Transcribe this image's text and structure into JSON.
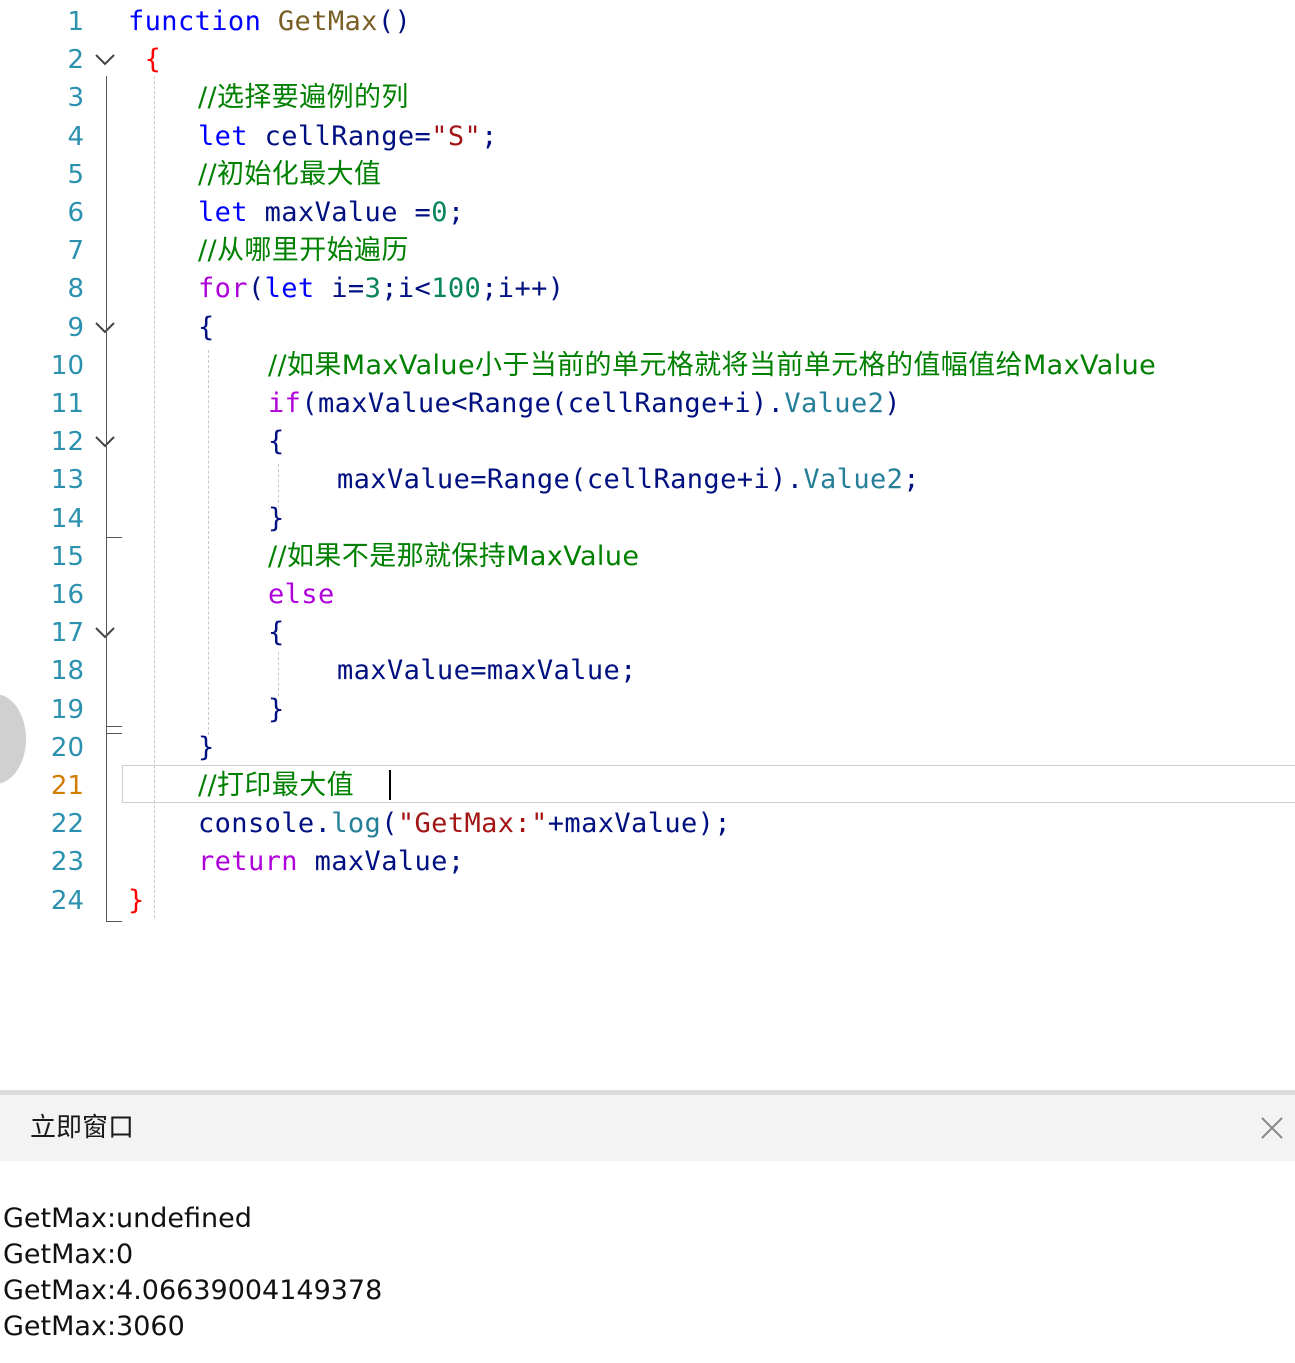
{
  "editor": {
    "active_line": 21,
    "lines": [
      {
        "n": "1",
        "fold": "",
        "indent": 0,
        "tokens": [
          [
            "kw",
            "function"
          ],
          [
            "plain",
            " "
          ],
          [
            "fn",
            "GetMax"
          ],
          [
            "plain",
            "()"
          ]
        ]
      },
      {
        "n": "2",
        "fold": "open",
        "indent": 0,
        "tokens": [
          [
            "plain",
            " "
          ],
          [
            "brace",
            "{"
          ]
        ]
      },
      {
        "n": "3",
        "fold": "",
        "indent": 1,
        "tokens": [
          [
            "cm",
            "//选择要遍例的列"
          ]
        ]
      },
      {
        "n": "4",
        "fold": "",
        "indent": 1,
        "tokens": [
          [
            "kw",
            "let"
          ],
          [
            "plain",
            " cellRange="
          ],
          [
            "str",
            "\"S\""
          ],
          [
            "plain",
            ";"
          ]
        ]
      },
      {
        "n": "5",
        "fold": "",
        "indent": 1,
        "tokens": [
          [
            "cm",
            "//初始化最大值"
          ]
        ]
      },
      {
        "n": "6",
        "fold": "",
        "indent": 1,
        "tokens": [
          [
            "kw",
            "let"
          ],
          [
            "plain",
            " maxValue ="
          ],
          [
            "num",
            "0"
          ],
          [
            "plain",
            ";"
          ]
        ]
      },
      {
        "n": "7",
        "fold": "",
        "indent": 1,
        "tokens": [
          [
            "cm",
            "//从哪里开始遍历"
          ]
        ]
      },
      {
        "n": "8",
        "fold": "",
        "indent": 1,
        "tokens": [
          [
            "ctl",
            "for"
          ],
          [
            "plain",
            "("
          ],
          [
            "kw",
            "let"
          ],
          [
            "plain",
            " i="
          ],
          [
            "num",
            "3"
          ],
          [
            "plain",
            ";i<"
          ],
          [
            "num",
            "100"
          ],
          [
            "plain",
            ";i++)"
          ]
        ]
      },
      {
        "n": "9",
        "fold": "open",
        "indent": 1,
        "tokens": [
          [
            "plain",
            "{"
          ]
        ]
      },
      {
        "n": "10",
        "fold": "",
        "indent": 2,
        "tokens": [
          [
            "cm",
            "//如果MaxValue小于当前的单元格就将当前单元格的值幅值给MaxValue"
          ]
        ]
      },
      {
        "n": "11",
        "fold": "",
        "indent": 2,
        "tokens": [
          [
            "ctl",
            "if"
          ],
          [
            "plain",
            "(maxValue<Range(cellRange+i)."
          ],
          [
            "prop",
            "Value2"
          ],
          [
            "plain",
            ")"
          ]
        ]
      },
      {
        "n": "12",
        "fold": "open",
        "indent": 2,
        "tokens": [
          [
            "plain",
            "{"
          ]
        ]
      },
      {
        "n": "13",
        "fold": "",
        "indent": 3,
        "tokens": [
          [
            "plain",
            "maxValue=Range(cellRange+i)."
          ],
          [
            "prop",
            "Value2"
          ],
          [
            "plain",
            ";"
          ]
        ]
      },
      {
        "n": "14",
        "fold": "",
        "indent": 2,
        "tokens": [
          [
            "plain",
            "}"
          ]
        ]
      },
      {
        "n": "15",
        "fold": "",
        "indent": 2,
        "tokens": [
          [
            "cm",
            "//如果不是那就保持MaxValue"
          ]
        ]
      },
      {
        "n": "16",
        "fold": "",
        "indent": 2,
        "tokens": [
          [
            "ctl",
            "else"
          ]
        ]
      },
      {
        "n": "17",
        "fold": "open",
        "indent": 2,
        "tokens": [
          [
            "plain",
            "{"
          ]
        ]
      },
      {
        "n": "18",
        "fold": "",
        "indent": 3,
        "tokens": [
          [
            "plain",
            "maxValue=maxValue;"
          ]
        ]
      },
      {
        "n": "19",
        "fold": "",
        "indent": 2,
        "tokens": [
          [
            "plain",
            "}"
          ]
        ]
      },
      {
        "n": "20",
        "fold": "",
        "indent": 1,
        "tokens": [
          [
            "plain",
            "}"
          ]
        ]
      },
      {
        "n": "21",
        "fold": "",
        "indent": 1,
        "tokens": [
          [
            "cm",
            "//打印最大值"
          ]
        ]
      },
      {
        "n": "22",
        "fold": "",
        "indent": 1,
        "tokens": [
          [
            "plain",
            "console."
          ],
          [
            "prop",
            "log"
          ],
          [
            "plain",
            "("
          ],
          [
            "str",
            "\"GetMax:\""
          ],
          [
            "plain",
            "+maxValue);"
          ]
        ]
      },
      {
        "n": "23",
        "fold": "",
        "indent": 1,
        "tokens": [
          [
            "ctl",
            "return"
          ],
          [
            "plain",
            " maxValue;"
          ]
        ]
      },
      {
        "n": "24",
        "fold": "",
        "indent": 0,
        "tokens": [
          [
            "brace",
            "}"
          ]
        ]
      }
    ]
  },
  "immediate_window": {
    "title": "立即窗口",
    "close_icon": "close-icon",
    "output": [
      "GetMax:undefined",
      "GetMax:0",
      "GetMax:4.06639004149378",
      "GetMax:3060"
    ]
  },
  "colors": {
    "line_number": "#2b91af",
    "active_line_number": "#d17d00",
    "keyword": "#0000ff",
    "comment": "#008000",
    "string": "#a31515",
    "number": "#098658",
    "control": "#af00db",
    "property": "#267f99",
    "brace": "#ff0000"
  }
}
